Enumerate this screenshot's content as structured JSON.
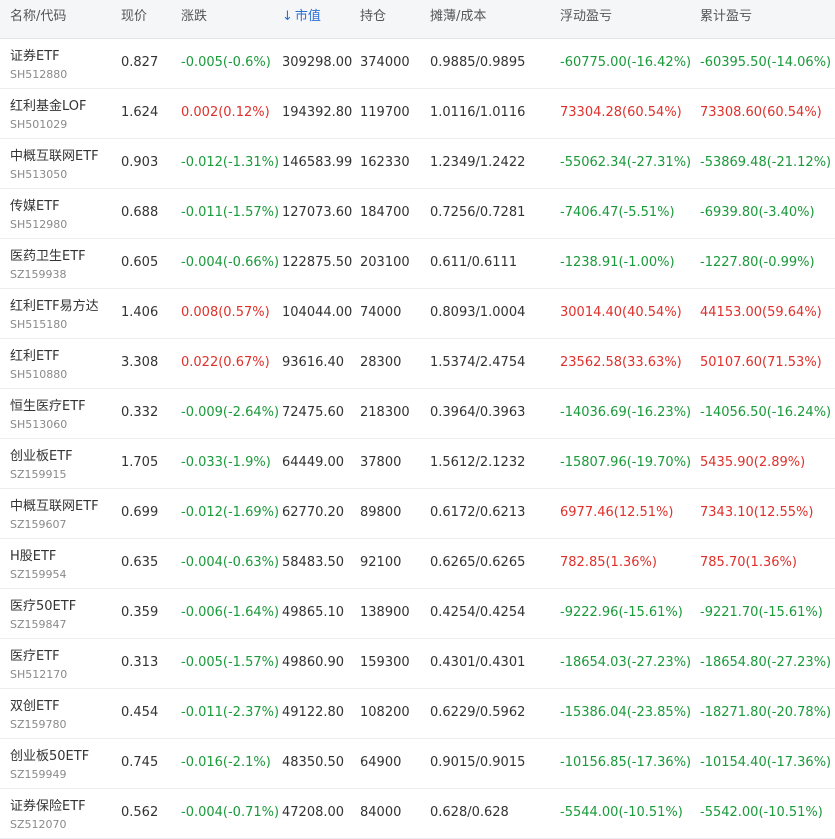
{
  "colors": {
    "up": "#e0302b",
    "down": "#1a9a3a",
    "sort": "#2a6fd6",
    "header_bg": "#f5f6f8"
  },
  "header": {
    "name_code": "名称/代码",
    "price": "现价",
    "change": "涨跌",
    "sort_icon": "arrow-down-icon",
    "sort_glyph": "↓",
    "market_value": "市值",
    "position": "持仓",
    "cost": "摊薄/成本",
    "float_pnl": "浮动盈亏",
    "total_pnl": "累计盈亏"
  },
  "rows": [
    {
      "name": "证券ETF",
      "code": "SH512880",
      "price": "0.827",
      "change": "-0.005(-0.6%)",
      "change_dir": "down",
      "market_value": "309298.00",
      "position": "374000",
      "cost": "0.9885/0.9895",
      "float_pnl": "-60775.00(-16.42%)",
      "float_dir": "down",
      "total_pnl": "-60395.50(-14.06%)",
      "total_dir": "down"
    },
    {
      "name": "红利基金LOF",
      "code": "SH501029",
      "price": "1.624",
      "change": "0.002(0.12%)",
      "change_dir": "up",
      "market_value": "194392.80",
      "position": "119700",
      "cost": "1.0116/1.0116",
      "float_pnl": "73304.28(60.54%)",
      "float_dir": "up",
      "total_pnl": "73308.60(60.54%)",
      "total_dir": "up"
    },
    {
      "name": "中概互联网ETF",
      "code": "SH513050",
      "price": "0.903",
      "change": "-0.012(-1.31%)",
      "change_dir": "down",
      "market_value": "146583.99",
      "position": "162330",
      "cost": "1.2349/1.2422",
      "float_pnl": "-55062.34(-27.31%)",
      "float_dir": "down",
      "total_pnl": "-53869.48(-21.12%)",
      "total_dir": "down"
    },
    {
      "name": "传媒ETF",
      "code": "SH512980",
      "price": "0.688",
      "change": "-0.011(-1.57%)",
      "change_dir": "down",
      "market_value": "127073.60",
      "position": "184700",
      "cost": "0.7256/0.7281",
      "float_pnl": "-7406.47(-5.51%)",
      "float_dir": "down",
      "total_pnl": "-6939.80(-3.40%)",
      "total_dir": "down"
    },
    {
      "name": "医药卫生ETF",
      "code": "SZ159938",
      "price": "0.605",
      "change": "-0.004(-0.66%)",
      "change_dir": "down",
      "market_value": "122875.50",
      "position": "203100",
      "cost": "0.611/0.6111",
      "float_pnl": "-1238.91(-1.00%)",
      "float_dir": "down",
      "total_pnl": "-1227.80(-0.99%)",
      "total_dir": "down"
    },
    {
      "name": "红利ETF易方达",
      "code": "SH515180",
      "price": "1.406",
      "change": "0.008(0.57%)",
      "change_dir": "up",
      "market_value": "104044.00",
      "position": "74000",
      "cost": "0.8093/1.0004",
      "float_pnl": "30014.40(40.54%)",
      "float_dir": "up",
      "total_pnl": "44153.00(59.64%)",
      "total_dir": "up"
    },
    {
      "name": "红利ETF",
      "code": "SH510880",
      "price": "3.308",
      "change": "0.022(0.67%)",
      "change_dir": "up",
      "market_value": "93616.40",
      "position": "28300",
      "cost": "1.5374/2.4754",
      "float_pnl": "23562.58(33.63%)",
      "float_dir": "up",
      "total_pnl": "50107.60(71.53%)",
      "total_dir": "up"
    },
    {
      "name": "恒生医疗ETF",
      "code": "SH513060",
      "price": "0.332",
      "change": "-0.009(-2.64%)",
      "change_dir": "down",
      "market_value": "72475.60",
      "position": "218300",
      "cost": "0.3964/0.3963",
      "float_pnl": "-14036.69(-16.23%)",
      "float_dir": "down",
      "total_pnl": "-14056.50(-16.24%)",
      "total_dir": "down"
    },
    {
      "name": "创业板ETF",
      "code": "SZ159915",
      "price": "1.705",
      "change": "-0.033(-1.9%)",
      "change_dir": "down",
      "market_value": "64449.00",
      "position": "37800",
      "cost": "1.5612/2.1232",
      "float_pnl": "-15807.96(-19.70%)",
      "float_dir": "down",
      "total_pnl": "5435.90(2.89%)",
      "total_dir": "up"
    },
    {
      "name": "中概互联网ETF",
      "code": "SZ159607",
      "price": "0.699",
      "change": "-0.012(-1.69%)",
      "change_dir": "down",
      "market_value": "62770.20",
      "position": "89800",
      "cost": "0.6172/0.6213",
      "float_pnl": "6977.46(12.51%)",
      "float_dir": "up",
      "total_pnl": "7343.10(12.55%)",
      "total_dir": "up"
    },
    {
      "name": "H股ETF",
      "code": "SZ159954",
      "price": "0.635",
      "change": "-0.004(-0.63%)",
      "change_dir": "down",
      "market_value": "58483.50",
      "position": "92100",
      "cost": "0.6265/0.6265",
      "float_pnl": "782.85(1.36%)",
      "float_dir": "up",
      "total_pnl": "785.70(1.36%)",
      "total_dir": "up"
    },
    {
      "name": "医疗50ETF",
      "code": "SZ159847",
      "price": "0.359",
      "change": "-0.006(-1.64%)",
      "change_dir": "down",
      "market_value": "49865.10",
      "position": "138900",
      "cost": "0.4254/0.4254",
      "float_pnl": "-9222.96(-15.61%)",
      "float_dir": "down",
      "total_pnl": "-9221.70(-15.61%)",
      "total_dir": "down"
    },
    {
      "name": "医疗ETF",
      "code": "SH512170",
      "price": "0.313",
      "change": "-0.005(-1.57%)",
      "change_dir": "down",
      "market_value": "49860.90",
      "position": "159300",
      "cost": "0.4301/0.4301",
      "float_pnl": "-18654.03(-27.23%)",
      "float_dir": "down",
      "total_pnl": "-18654.80(-27.23%)",
      "total_dir": "down"
    },
    {
      "name": "双创ETF",
      "code": "SZ159780",
      "price": "0.454",
      "change": "-0.011(-2.37%)",
      "change_dir": "down",
      "market_value": "49122.80",
      "position": "108200",
      "cost": "0.6229/0.5962",
      "float_pnl": "-15386.04(-23.85%)",
      "float_dir": "down",
      "total_pnl": "-18271.80(-20.78%)",
      "total_dir": "down"
    },
    {
      "name": "创业板50ETF",
      "code": "SZ159949",
      "price": "0.745",
      "change": "-0.016(-2.1%)",
      "change_dir": "down",
      "market_value": "48350.50",
      "position": "64900",
      "cost": "0.9015/0.9015",
      "float_pnl": "-10156.85(-17.36%)",
      "float_dir": "down",
      "total_pnl": "-10154.40(-17.36%)",
      "total_dir": "down"
    },
    {
      "name": "证券保险ETF",
      "code": "SZ512070",
      "price": "0.562",
      "change": "-0.004(-0.71%)",
      "change_dir": "down",
      "market_value": "47208.00",
      "position": "84000",
      "cost": "0.628/0.628",
      "float_pnl": "-5544.00(-10.51%)",
      "float_dir": "down",
      "total_pnl": "-5542.00(-10.51%)",
      "total_dir": "down"
    }
  ]
}
